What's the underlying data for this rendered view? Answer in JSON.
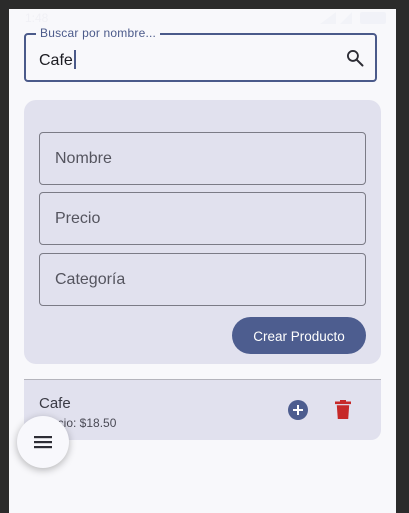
{
  "status_bar": {
    "time": "1:48"
  },
  "search": {
    "label": "Buscar por nombre...",
    "value": "Cafe",
    "icon": "search-icon"
  },
  "form": {
    "fields": [
      {
        "placeholder": "Nombre"
      },
      {
        "placeholder": "Precio"
      },
      {
        "placeholder": "Categoría"
      }
    ],
    "create_button": "Crear Producto"
  },
  "products": [
    {
      "name": "Cafe",
      "price": "Precio: $18.50"
    }
  ],
  "fab": {
    "icon": "menu-icon"
  },
  "colors": {
    "primary": "#4d5d8f",
    "surface": "#e1e1ee",
    "background": "#f8f8fb",
    "delete": "#c62828"
  }
}
